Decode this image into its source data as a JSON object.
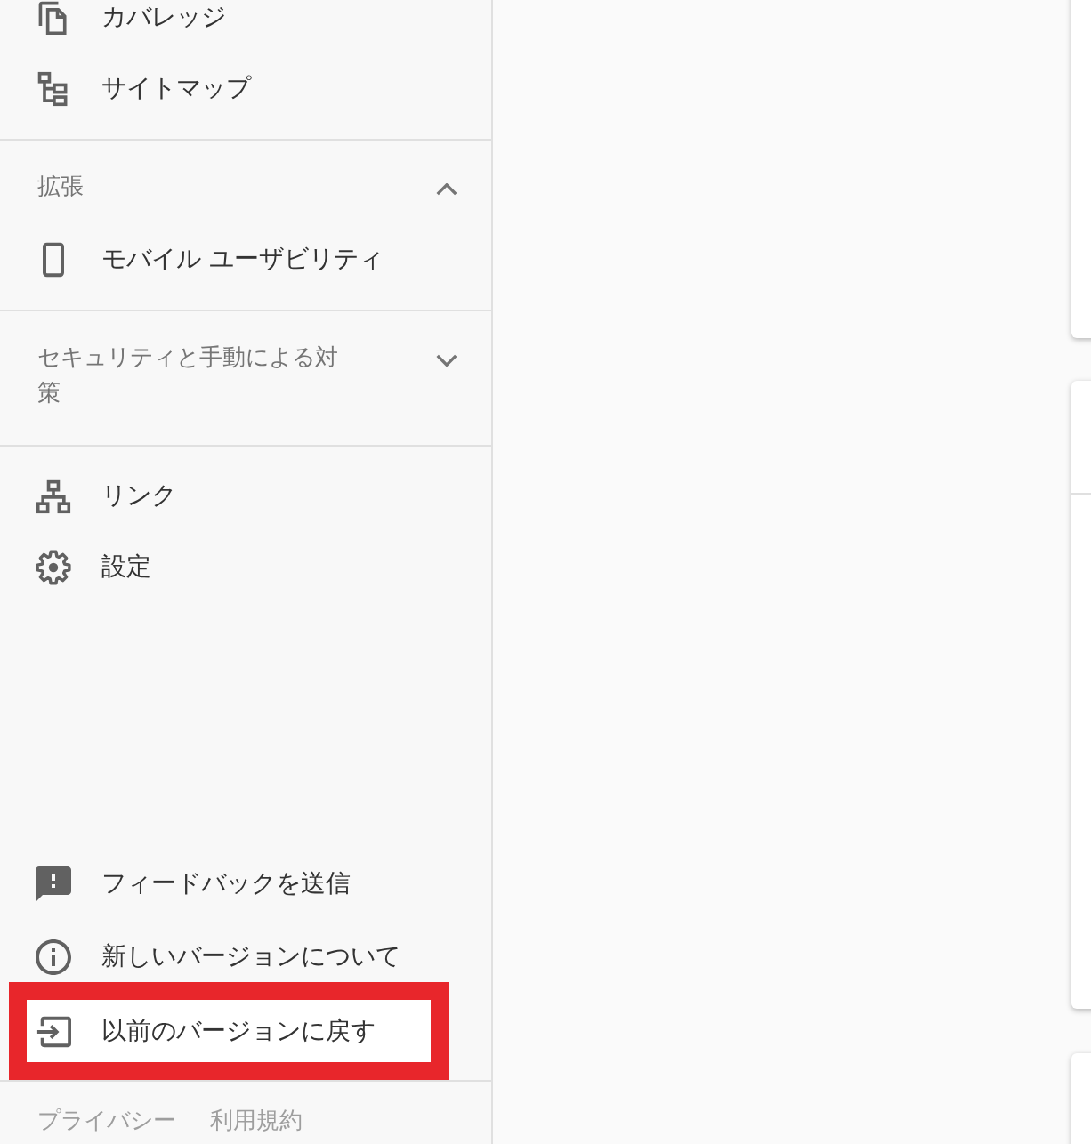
{
  "sidebar": {
    "sections": [
      {
        "items": [
          {
            "label": "カバレッジ"
          },
          {
            "label": "サイトマップ"
          }
        ]
      },
      {
        "header": "拡張",
        "expanded": true,
        "items": [
          {
            "label": "モバイル ユーザビリティ"
          }
        ]
      },
      {
        "header": "セキュリティと手動による対策",
        "expanded": false
      },
      {
        "items": [
          {
            "label": "リンク"
          },
          {
            "label": "設定"
          }
        ]
      }
    ],
    "footer_items": [
      {
        "label": "フィードバックを送信",
        "highlighted": false
      },
      {
        "label": "新しいバージョンについて",
        "highlighted": false
      },
      {
        "label": "以前のバージョンに戻す",
        "highlighted": true
      }
    ],
    "footer_links": [
      "プライバシー",
      "利用規約"
    ]
  }
}
